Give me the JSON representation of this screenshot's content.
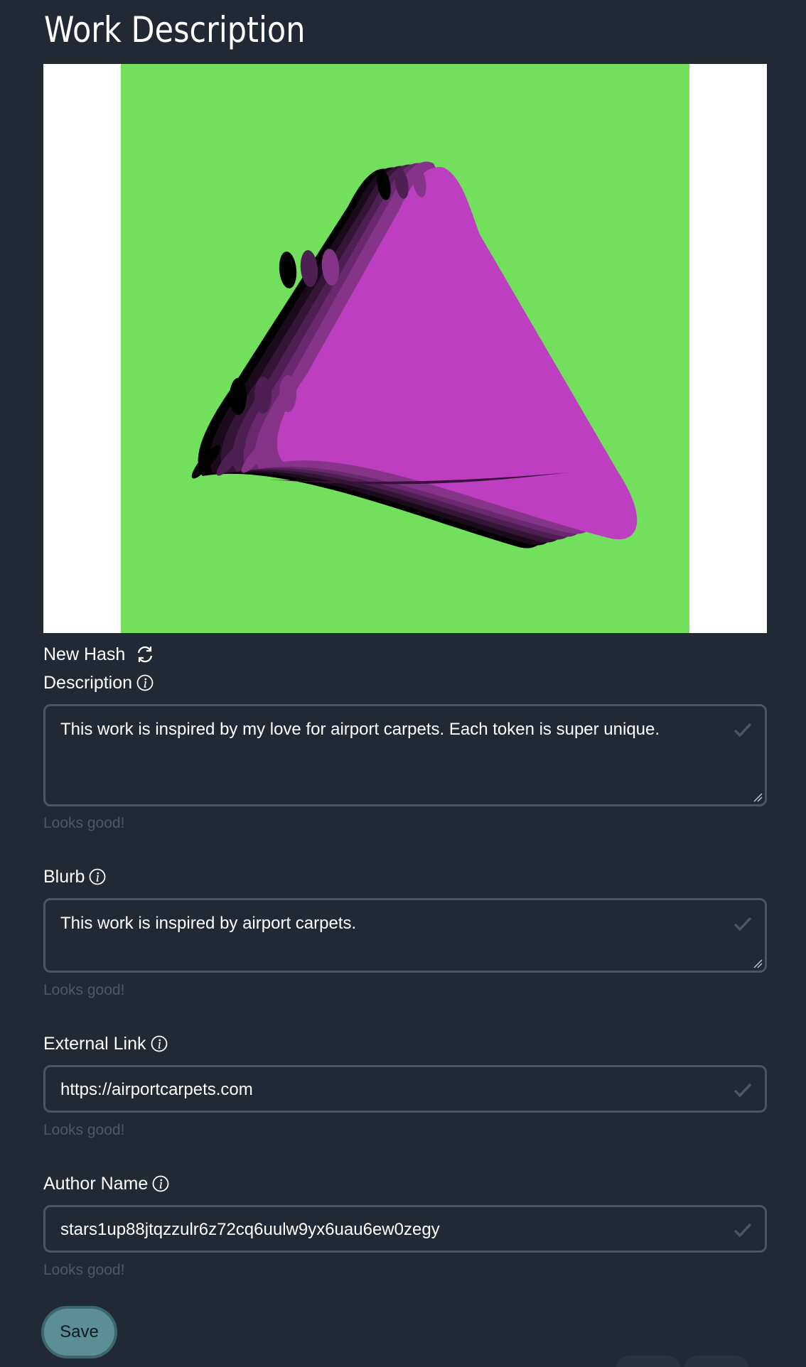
{
  "page": {
    "title": "Work Description"
  },
  "preview": {
    "background_color": "#ffffff",
    "canvas_color": "#72e05d",
    "shape_color": "#bd3ec0"
  },
  "hash": {
    "label": "New Hash",
    "icon": "refresh-icon"
  },
  "form": {
    "description": {
      "label": "Description",
      "value": "This work is inspired by my love for airport carpets. Each token is super unique.",
      "feedback": "Looks good!"
    },
    "blurb": {
      "label": "Blurb",
      "value": "This work is inspired by airport carpets.",
      "feedback": "Looks good!"
    },
    "external_link": {
      "label": "External Link",
      "value": "https://airportcarpets.com",
      "feedback": "Looks good!"
    },
    "author_name": {
      "label": "Author Name",
      "value": "stars1up88jtqzzulr6z72cq6uulw9yx6uau6ew0zegy",
      "feedback": "Looks good!"
    }
  },
  "actions": {
    "save_label": "Save"
  },
  "colors": {
    "background": "#212a34",
    "field_border": "#4a5663",
    "feedback_text": "#4c5866",
    "save_button": "#5c8e98"
  }
}
